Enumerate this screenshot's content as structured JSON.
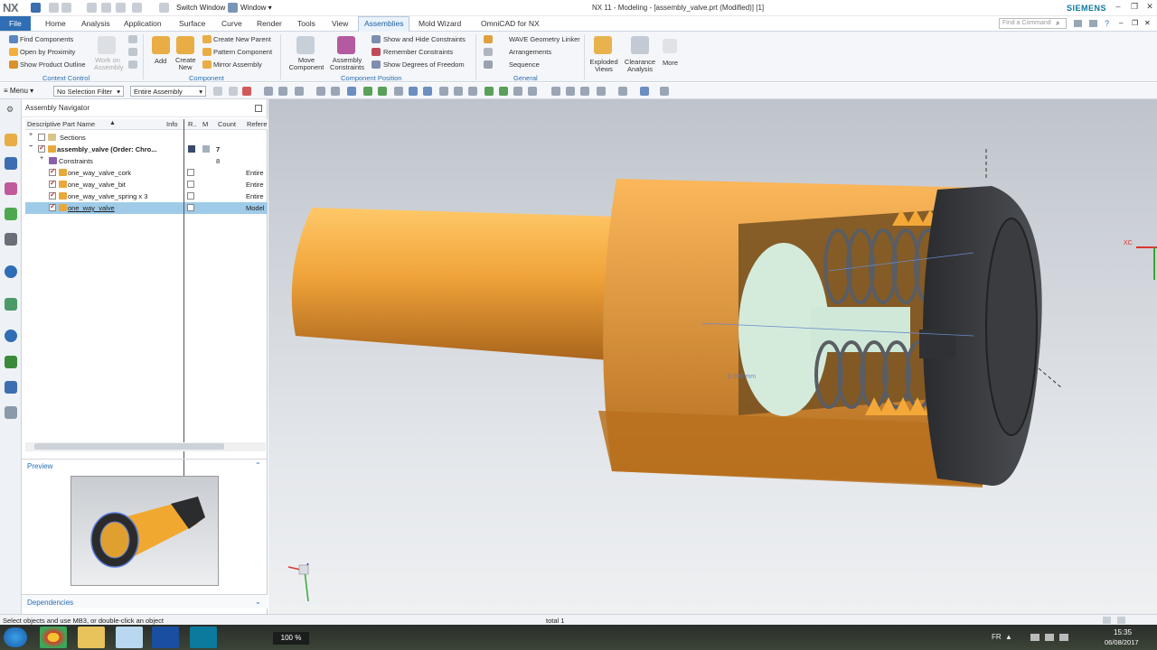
{
  "titlebar": {
    "logo": "NX",
    "switch_window": "Switch Window",
    "window_menu": "Window",
    "title": "NX 11 - Modeling - [assembly_valve.prt (Modified)]  [1]",
    "brand": "SIEMENS"
  },
  "tabs": [
    "File",
    "Home",
    "Analysis",
    "Application",
    "Surface",
    "Curve",
    "Render",
    "Tools",
    "View",
    "Assemblies",
    "Mold Wizard",
    "OmniCAD for NX"
  ],
  "active_tab": "Assemblies",
  "search_placeholder": "Find a Command",
  "ribbon": {
    "context_control": {
      "items": [
        "Find Components",
        "Open by Proximity",
        "Show Product Outline"
      ],
      "work_on_assembly": "Work on Assembly",
      "label": "Context Control"
    },
    "component": {
      "add": "Add",
      "create_new": "Create New",
      "items": [
        "Create New Parent",
        "Pattern Component",
        "Mirror Assembly"
      ],
      "label": "Component"
    },
    "component_position": {
      "move_component": "Move Component",
      "assembly_constraints": "Assembly Constraints",
      "items": [
        "Show and Hide Constraints",
        "Remember Constraints",
        "Show Degrees of Freedom"
      ],
      "label": "Component Position"
    },
    "general": {
      "items": [
        "WAVE Geometry Linker",
        "Arrangements",
        "Sequence"
      ],
      "label": "General"
    },
    "exploded_views": "Exploded Views",
    "clearance_analysis": "Clearance Analysis",
    "more": "More"
  },
  "selbar": {
    "menu": "Menu",
    "filter": "No Selection Filter",
    "scope": "Entire Assembly"
  },
  "navigator": {
    "title": "Assembly Navigator",
    "columns": [
      "Descriptive Part Name",
      "Info",
      "R..",
      "M",
      "Count",
      "Refere"
    ],
    "rows": [
      {
        "name": "Sections",
        "count": "",
        "ref": ""
      },
      {
        "name": "assembly_valve (Order: Chro...",
        "count": "7",
        "ref": ""
      },
      {
        "name": "Constraints",
        "count": "8",
        "ref": ""
      },
      {
        "name": "one_way_valve_cork",
        "count": "",
        "ref": "Entire"
      },
      {
        "name": "one_way_valve_bit",
        "count": "",
        "ref": "Entire"
      },
      {
        "name": "one_way_valve_spring x 3",
        "count": "",
        "ref": "Entire"
      },
      {
        "name": "one_way_valve",
        "count": "",
        "ref": "Model"
      }
    ],
    "preview_label": "Preview",
    "dependencies_label": "Dependencies"
  },
  "viewport": {
    "dimension_label": "8.000 mm",
    "axis_label": "XC"
  },
  "status": {
    "prompt": "Select objects and use MB3, or double-click an object",
    "total": "total 1"
  },
  "taskbar": {
    "zoom": "100 %",
    "lang": "FR",
    "time": "15:35",
    "date": "06/08/2017"
  },
  "colors": {
    "accent": "#2f6db4",
    "part_orange": "#f0a33a",
    "part_dark": "#3b3d40",
    "part_mint": "#cfe8d8",
    "selection": "#9fcbe8"
  }
}
